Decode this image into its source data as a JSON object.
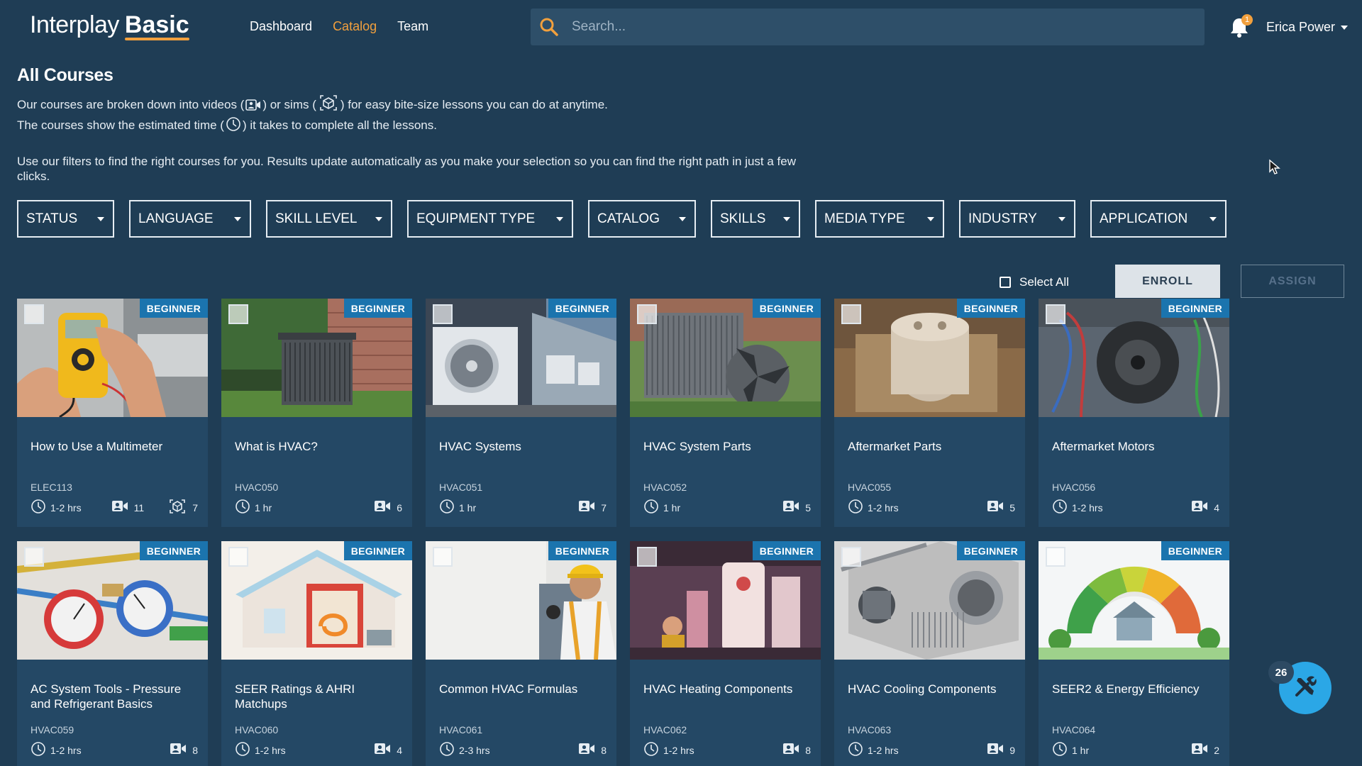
{
  "header": {
    "logo_main": "Interplay",
    "logo_sub": "Basic",
    "nav": [
      {
        "label": "Dashboard",
        "active": false
      },
      {
        "label": "Catalog",
        "active": true
      },
      {
        "label": "Team",
        "active": false
      }
    ],
    "search_placeholder": "Search...",
    "notification_count": "1",
    "user_name": "Erica Power"
  },
  "intro": {
    "title": "All Courses",
    "line1_a": "Our courses are broken down into videos (",
    "line1_b": ") or sims (",
    "line1_c": ") for easy bite-size lessons you can do at anytime.",
    "line2_a": "The courses show the estimated time (",
    "line2_b": ") it takes to complete all the lessons.",
    "line3": "Use our filters to find the right courses for you. Results update automatically as you make your selection so you can find the right path in just a few",
    "line4": "clicks."
  },
  "filters": [
    "STATUS",
    "LANGUAGE",
    "SKILL LEVEL",
    "EQUIPMENT TYPE",
    "CATALOG",
    "SKILLS",
    "MEDIA TYPE",
    "INDUSTRY",
    "APPLICATION"
  ],
  "actions": {
    "select_all": "Select All",
    "enroll": "ENROLL",
    "assign": "ASSIGN"
  },
  "colors": {
    "background": "#1f3d55",
    "card": "#244865",
    "accent": "#f2a03d",
    "badge": "#1b74ae",
    "fab": "#2ba7e6"
  },
  "courses": [
    {
      "title": "How to Use a Multimeter",
      "code": "ELEC113",
      "time": "1-2 hrs",
      "videos": "11",
      "sims": "7",
      "level": "BEGINNER",
      "image": "multimeter"
    },
    {
      "title": "What is HVAC?",
      "code": "HVAC050",
      "time": "1 hr",
      "videos": "6",
      "level": "BEGINNER",
      "image": "outdoor-ac-unit"
    },
    {
      "title": "HVAC Systems",
      "code": "HVAC051",
      "time": "1 hr",
      "videos": "7",
      "level": "BEGINNER",
      "image": "mini-split-units"
    },
    {
      "title": "HVAC System Parts",
      "code": "HVAC052",
      "time": "1 hr",
      "videos": "5",
      "level": "BEGINNER",
      "image": "condenser-fan"
    },
    {
      "title": "Aftermarket Parts",
      "code": "HVAC055",
      "time": "1-2 hrs",
      "videos": "5",
      "level": "BEGINNER",
      "image": "capacitor"
    },
    {
      "title": "Aftermarket Motors",
      "code": "HVAC056",
      "time": "1-2 hrs",
      "videos": "4",
      "level": "BEGINNER",
      "image": "motor"
    },
    {
      "title": "AC System Tools - Pressure and Refrigerant Basics",
      "code": "HVAC059",
      "time": "1-2 hrs",
      "videos": "8",
      "level": "BEGINNER",
      "image": "gauges"
    },
    {
      "title": "SEER Ratings & AHRI Matchups",
      "code": "HVAC060",
      "time": "1-2 hrs",
      "videos": "4",
      "level": "BEGINNER",
      "image": "house-cutaway"
    },
    {
      "title": "Common HVAC Formulas",
      "code": "HVAC061",
      "time": "2-3 hrs",
      "videos": "8",
      "level": "BEGINNER",
      "image": "technician"
    },
    {
      "title": "HVAC Heating Components",
      "code": "HVAC062",
      "time": "1-2 hrs",
      "videos": "8",
      "level": "BEGINNER",
      "image": "furnace-room"
    },
    {
      "title": "HVAC Cooling Components",
      "code": "HVAC063",
      "time": "1-2 hrs",
      "videos": "9",
      "level": "BEGINNER",
      "image": "cooling-cutaway"
    },
    {
      "title": "SEER2 & Energy Efficiency",
      "code": "HVAC064",
      "time": "1 hr",
      "videos": "2",
      "level": "BEGINNER",
      "image": "efficiency-gauge"
    }
  ],
  "fab": {
    "count": "26",
    "icon": "tools-icon"
  }
}
